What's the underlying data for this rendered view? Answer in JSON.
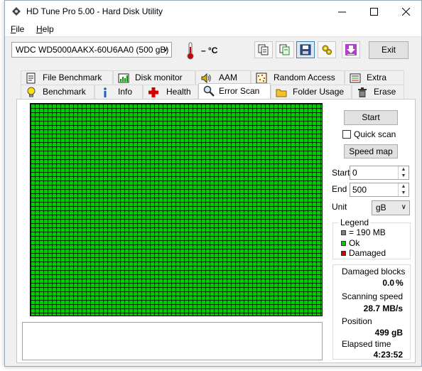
{
  "window": {
    "title": "HD Tune Pro 5.00 - Hard Disk Utility"
  },
  "menu": {
    "file_prefix": "F",
    "file_rest": "ile",
    "help_prefix": "H",
    "help_rest": "elp"
  },
  "toolbar": {
    "drive": "WDC WD5000AAKX-60U6AA0  (500 gB)",
    "temperature": "– °C",
    "exit_label": "Exit"
  },
  "tabs_top": [
    {
      "label": "File Benchmark",
      "icon": "file-benchmark-icon"
    },
    {
      "label": "Disk monitor",
      "icon": "disk-monitor-icon"
    },
    {
      "label": "AAM",
      "icon": "speaker-icon"
    },
    {
      "label": "Random Access",
      "icon": "random-access-icon"
    },
    {
      "label": "Extra tests",
      "icon": "extra-tests-icon"
    }
  ],
  "tabs_bottom": [
    {
      "label": "Benchmark",
      "icon": "bulb-icon"
    },
    {
      "label": "Info",
      "icon": "info-icon"
    },
    {
      "label": "Health",
      "icon": "health-cross-icon"
    },
    {
      "label": "Error Scan",
      "icon": "magnifier-icon",
      "selected": true
    },
    {
      "label": "Folder Usage",
      "icon": "folder-icon"
    },
    {
      "label": "Erase",
      "icon": "trash-icon"
    }
  ],
  "controls": {
    "start_label": "Start",
    "quick_scan_label": "Quick scan",
    "quick_scan_checked": false,
    "speed_map_label": "Speed map",
    "start_field_label": "Start",
    "start_value": "0",
    "end_field_label": "End",
    "end_value": "500",
    "unit_label": "Unit",
    "unit_value": "gB"
  },
  "legend": {
    "title": "Legend",
    "block_size": "= 190 MB",
    "ok": "Ok",
    "damaged": "Damaged"
  },
  "stats": {
    "damaged_label": "Damaged blocks",
    "damaged_value": "0.0",
    "damaged_unit": "%",
    "speed_label": "Scanning speed",
    "speed_value": "28.7 MB/s",
    "position_label": "Position",
    "position_value": "499 gB",
    "elapsed_label": "Elapsed time",
    "elapsed_value": "4:23:52"
  },
  "colors": {
    "ok": "#00cc00",
    "damaged": "#cc0000",
    "block": "#808080"
  }
}
